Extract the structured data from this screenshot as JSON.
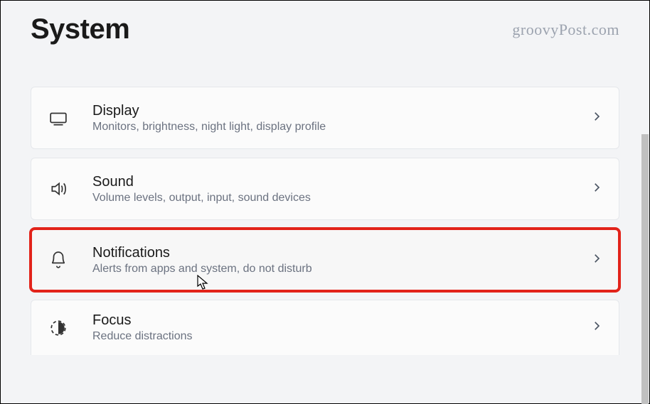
{
  "header": {
    "title": "System",
    "watermark": "groovyPost.com"
  },
  "items": [
    {
      "icon": "display-icon",
      "title": "Display",
      "desc": "Monitors, brightness, night light, display profile",
      "highlighted": false
    },
    {
      "icon": "sound-icon",
      "title": "Sound",
      "desc": "Volume levels, output, input, sound devices",
      "highlighted": false
    },
    {
      "icon": "bell-icon",
      "title": "Notifications",
      "desc": "Alerts from apps and system, do not disturb",
      "highlighted": true
    },
    {
      "icon": "focus-icon",
      "title": "Focus",
      "desc": "Reduce distractions",
      "highlighted": false
    }
  ]
}
